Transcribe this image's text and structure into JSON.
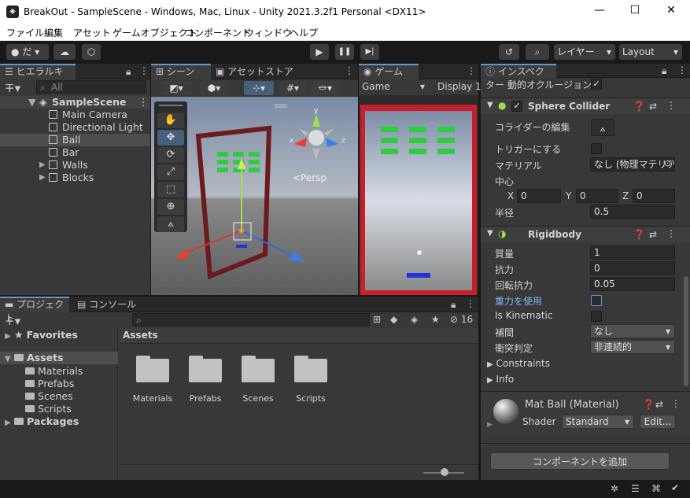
{
  "window": {
    "title": "BreakOut - SampleScene - Windows, Mac, Linux - Unity 2021.3.2f1 Personal <DX11>",
    "logo_glyph": "◈",
    "controls": {
      "minimize": "—",
      "maximize": "☐",
      "close": "✕"
    }
  },
  "menu": [
    "ファイル",
    "編集",
    "アセット",
    "ゲームオブジェクト",
    "コンポーネント",
    "ウィンドウ",
    "ヘルプ"
  ],
  "toolbar": {
    "account": "だ",
    "play_controls": [
      "▶",
      "❚❚",
      "▶|"
    ],
    "layers": "レイヤー",
    "layout": "Layout"
  },
  "hierarchy": {
    "tab": "ヒエラルキー",
    "search_placeholder": "All",
    "scene": "SampleScene",
    "items": [
      {
        "label": "Main Camera",
        "expandable": false,
        "selected": false
      },
      {
        "label": "Directional Light",
        "expandable": false,
        "selected": false
      },
      {
        "label": "Ball",
        "expandable": false,
        "selected": true
      },
      {
        "label": "Bar",
        "expandable": false,
        "selected": false
      },
      {
        "label": "Walls",
        "expandable": true,
        "selected": false
      },
      {
        "label": "Blocks",
        "expandable": true,
        "selected": false
      }
    ]
  },
  "scene_view": {
    "tabs": [
      "シーン",
      "アセットストア"
    ],
    "persp_label": "<Persp",
    "gizmo_axes": {
      "y": "y",
      "x": "x",
      "z": "z"
    }
  },
  "game_view": {
    "tab": "ゲーム",
    "display_mode": "Game",
    "display": "Display 1"
  },
  "project": {
    "tabs": [
      "プロジェクト",
      "コンソール"
    ],
    "hidden_count": "16",
    "favorites": "Favorites",
    "assets_root": "Assets",
    "asset_folders": [
      "Materials",
      "Prefabs",
      "Scenes",
      "Scripts"
    ],
    "packages": "Packages",
    "breadcrumb": "Assets"
  },
  "inspector": {
    "tab": "インスペクター",
    "dynamic_occlusion": "動的オクルージョン",
    "sphere_collider": {
      "title": "Sphere Collider",
      "edit_collider": "コライダーの編集",
      "is_trigger": "トリガーにする",
      "material_label": "マテリアル",
      "material_value": "なし (物理マテリア",
      "center_label": "中心",
      "center": {
        "x": "0",
        "y": "0",
        "z": "0"
      },
      "center_axes": {
        "x": "X",
        "y": "Y",
        "z": "Z"
      },
      "radius_label": "半径",
      "radius": "0.5"
    },
    "rigidbody": {
      "title": "Rigidbody",
      "fields": [
        {
          "label": "質量",
          "value": "1"
        },
        {
          "label": "抗力",
          "value": "0"
        },
        {
          "label": "回転抗力",
          "value": "0.05"
        }
      ],
      "use_gravity": "重力を使用",
      "is_kinematic": "Is Kinematic",
      "interpolate_label": "補間",
      "interpolate": "なし",
      "collision_label": "衝突判定",
      "collision": "非連続的",
      "constraints": "Constraints",
      "info": "Info"
    },
    "material": {
      "title": "Mat Ball (Material)",
      "shader_label": "Shader",
      "shader": "Standard",
      "edit": "Edit..."
    },
    "add_component": "コンポーネントを追加"
  },
  "colors": {
    "accent": "#5a9ad8",
    "panel": "#383838",
    "selected": "#4d4d4d",
    "brick": "#2ecc40"
  }
}
